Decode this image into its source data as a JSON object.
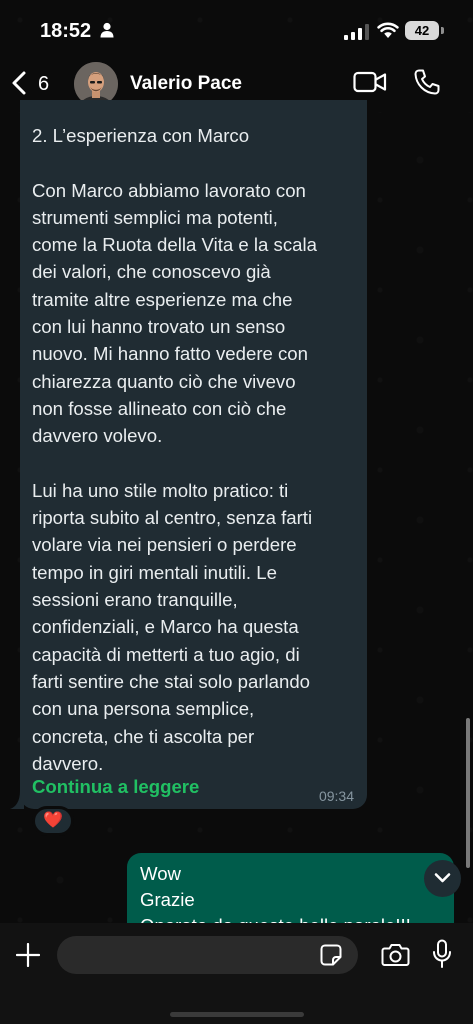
{
  "status_bar": {
    "time": "18:52",
    "battery": "42"
  },
  "header": {
    "back_count": "6",
    "contact_name": "Valerio Pace"
  },
  "messages": {
    "incoming": {
      "text": "2. L’esperienza con Marco\n\nCon Marco abbiamo lavorato con\nstrumenti semplici ma potenti,\ncome la Ruota della Vita e la scala\ndei valori, che conoscevo già\ntramite altre esperienze ma che\ncon lui hanno trovato un senso\nnuovo. Mi hanno fatto vedere con\nchiarezza quanto ciò che vivevo\nnon fosse allineato con ciò che\ndavvero volevo.\n\nLui ha uno stile molto pratico: ti\nriporta subito al centro, senza farti\nvolare via nei pensieri o perdere\ntempo in giri mentali inutili. Le\nsessioni erano tranquille,\nconfidenziali, e Marco ha questa\ncapacità di metterti a tuo agio, di\nfarti sentire che stai solo parlando\ncon una persona semplice,\nconcreta, che ti ascolta per\ndavvero.",
      "read_more": "Continua a leggere",
      "time": "09:34",
      "reaction": "❤️"
    },
    "outgoing": {
      "text": "Wow\nGrazie\nOnorato da queste belle parole!!!"
    }
  },
  "composer": {
    "placeholder": ""
  },
  "colors": {
    "incoming_bubble": "#202c33",
    "outgoing_bubble": "#005c4b",
    "accent_green": "#21c063",
    "background": "#0b0b0b"
  },
  "icons": [
    "person-icon",
    "signal-icon",
    "wifi-icon",
    "battery-icon",
    "back-chevron-icon",
    "video-call-icon",
    "phone-icon",
    "heart-icon",
    "chevron-down-icon",
    "plus-icon",
    "sticker-icon",
    "camera-icon",
    "mic-icon"
  ]
}
